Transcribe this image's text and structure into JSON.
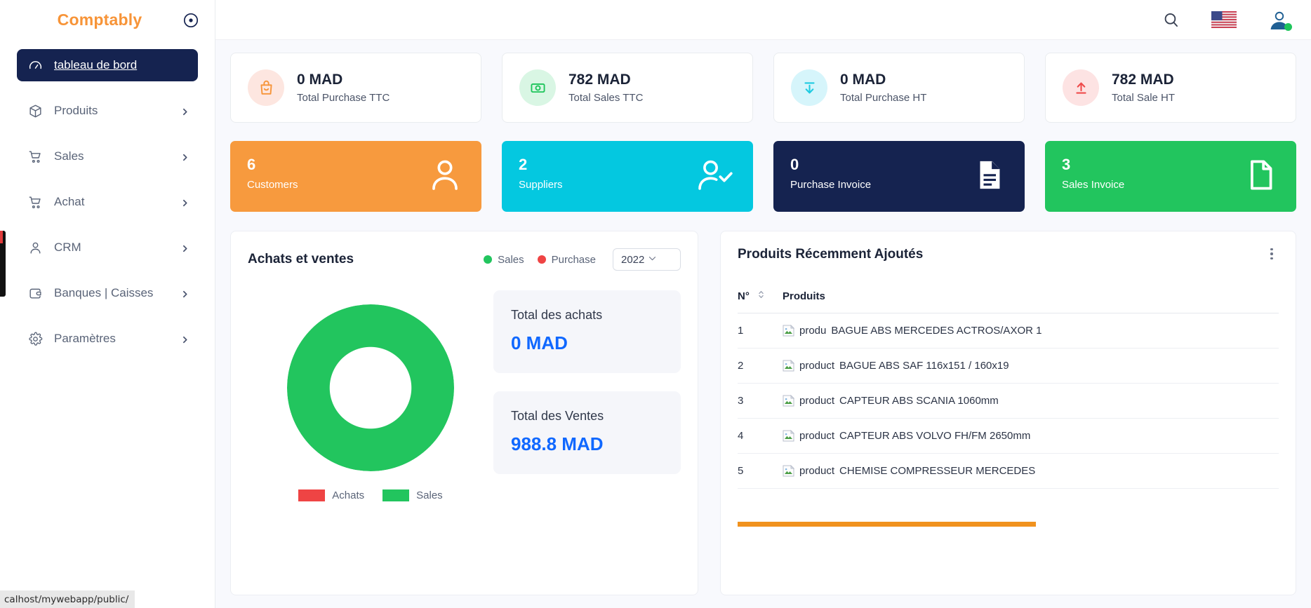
{
  "brand": {
    "name": "Comptably",
    "toggle_icon": "record-circle-icon"
  },
  "sidebar": {
    "items": [
      {
        "label": "tableau de bord",
        "icon": "dashboard-icon",
        "active": true,
        "has_chevron": false
      },
      {
        "label": "Produits",
        "icon": "box-icon",
        "active": false,
        "has_chevron": true
      },
      {
        "label": "Sales",
        "icon": "cart-icon",
        "active": false,
        "has_chevron": true
      },
      {
        "label": "Achat",
        "icon": "cart-icon",
        "active": false,
        "has_chevron": true
      },
      {
        "label": "CRM",
        "icon": "user-icon",
        "active": false,
        "has_chevron": true
      },
      {
        "label": "Banques | Caisses",
        "icon": "wallet-icon",
        "active": false,
        "has_chevron": true
      },
      {
        "label": "Paramètres",
        "icon": "gear-icon",
        "active": false,
        "has_chevron": true
      }
    ]
  },
  "topbar": {
    "search_icon": "search-icon",
    "language_icon": "us-flag-icon",
    "account_icon": "user-avatar-icon",
    "online_status_color": "#1ec55b"
  },
  "stats": [
    {
      "value": "0 MAD",
      "label": "Total Purchase TTC",
      "icon": "shopping-bag-icon",
      "bubble_color": "#fde6e0",
      "icon_color": "#f79438"
    },
    {
      "value": "782 MAD",
      "label": "Total Sales TTC",
      "icon": "money-icon",
      "bubble_color": "#d9f6e4",
      "icon_color": "#1ec55b"
    },
    {
      "value": "0 MAD",
      "label": "Total Purchase HT",
      "icon": "download-icon",
      "bubble_color": "#d6f5fb",
      "icon_color": "#1ecbe1"
    },
    {
      "value": "782 MAD",
      "label": "Total Sale HT",
      "icon": "upload-icon",
      "bubble_color": "#fde3e3",
      "icon_color": "#ef4b4b"
    }
  ],
  "kpis": [
    {
      "count": "6",
      "label": "Customers",
      "color": "#f79a3e",
      "icon": "person-icon"
    },
    {
      "count": "2",
      "label": "Suppliers",
      "color": "#04c8e0",
      "icon": "person-check-icon"
    },
    {
      "count": "0",
      "label": "Purchase Invoice",
      "color": "#152350",
      "icon": "document-lines-icon"
    },
    {
      "count": "3",
      "label": "Sales Invoice",
      "color": "#22c55e",
      "icon": "document-icon"
    }
  ],
  "chart_panel": {
    "title": "Achats et ventes",
    "legend": [
      {
        "label": "Sales",
        "color": "#22c55e"
      },
      {
        "label": "Purchase",
        "color": "#ef4444"
      }
    ],
    "year_selected": "2022",
    "year_chevron_icon": "chevron-down-icon",
    "donut_legend": [
      {
        "label": "Achats",
        "color": "#ef4444"
      },
      {
        "label": "Sales",
        "color": "#22c55e"
      }
    ],
    "totals": [
      {
        "label": "Total des achats",
        "value": "0 MAD"
      },
      {
        "label": "Total des Ventes",
        "value": "988.8 MAD"
      }
    ]
  },
  "chart_data": {
    "type": "pie",
    "title": "Achats et ventes",
    "subtitle": "",
    "variant": "donut",
    "legend_position": "bottom",
    "year": "2022",
    "labels": [
      "Achats",
      "Sales"
    ],
    "values": [
      0,
      988.8
    ],
    "colors": [
      "#ef4444",
      "#22c55e"
    ],
    "units": "MAD",
    "series": [
      {
        "name": "Achats",
        "value": 0,
        "color": "#ef4444",
        "percent": 0
      },
      {
        "name": "Sales",
        "value": 988.8,
        "color": "#22c55e",
        "percent": 100
      }
    ],
    "annotations": [
      {
        "label": "Total des achats",
        "value": "0 MAD"
      },
      {
        "label": "Total des Ventes",
        "value": "988.8 MAD"
      }
    ],
    "top_legend": [
      {
        "label": "Sales",
        "color": "#22c55e"
      },
      {
        "label": "Purchase",
        "color": "#ef4444"
      }
    ]
  },
  "products_panel": {
    "title": "Produits Récemment Ajoutés",
    "menu_icon": "kebab-menu-icon",
    "columns": [
      "N°",
      "Produits"
    ],
    "sort_icon": "sort-icon",
    "rows": [
      {
        "num": "1",
        "alt": "produ",
        "name": "BAGUE ABS MERCEDES ACTROS/AXOR 1",
        "image_icon": "broken-image-icon"
      },
      {
        "num": "2",
        "alt": "product",
        "name": "BAGUE ABS SAF 116x151 / 160x19",
        "image_icon": "broken-image-icon"
      },
      {
        "num": "3",
        "alt": "product",
        "name": "CAPTEUR ABS SCANIA 1060mm",
        "image_icon": "broken-image-icon"
      },
      {
        "num": "4",
        "alt": "product",
        "name": "CAPTEUR ABS VOLVO FH/FM 2650mm",
        "image_icon": "broken-image-icon"
      },
      {
        "num": "5",
        "alt": "product",
        "name": "CHEMISE COMPRESSEUR MERCEDES",
        "image_icon": "broken-image-icon"
      }
    ],
    "scrollbar_color": "#f1921e"
  },
  "statusbar": {
    "url": "calhost/mywebapp/public/"
  }
}
